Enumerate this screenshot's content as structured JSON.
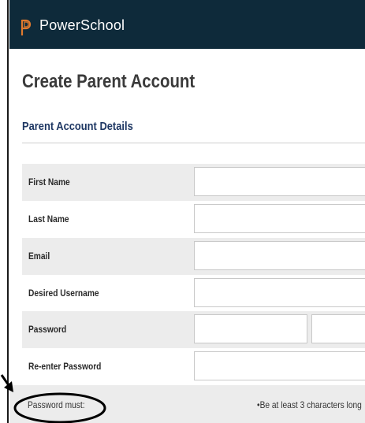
{
  "header": {
    "brand": "PowerSchool",
    "logo_icon": "powerschool-logo-icon",
    "background": "#0e2a3a"
  },
  "page": {
    "title": "Create Parent Account"
  },
  "section": {
    "title": "Parent Account Details",
    "title_color": "#1e3763"
  },
  "form": {
    "first_name_label": "First Name",
    "last_name_label": "Last Name",
    "email_label": "Email",
    "username_label": "Desired Username",
    "password_label": "Password",
    "reenter_password_label": "Re-enter Password",
    "first_name_value": "",
    "last_name_value": "",
    "email_value": "",
    "username_value": "",
    "password_value": "",
    "reenter_password_value": ""
  },
  "password_hint": {
    "label": "Password must:",
    "rule": "•Be at least 3 characters long"
  },
  "annotation": {
    "icon": "circle-arrow-annotation-icon",
    "color": "#000000"
  }
}
